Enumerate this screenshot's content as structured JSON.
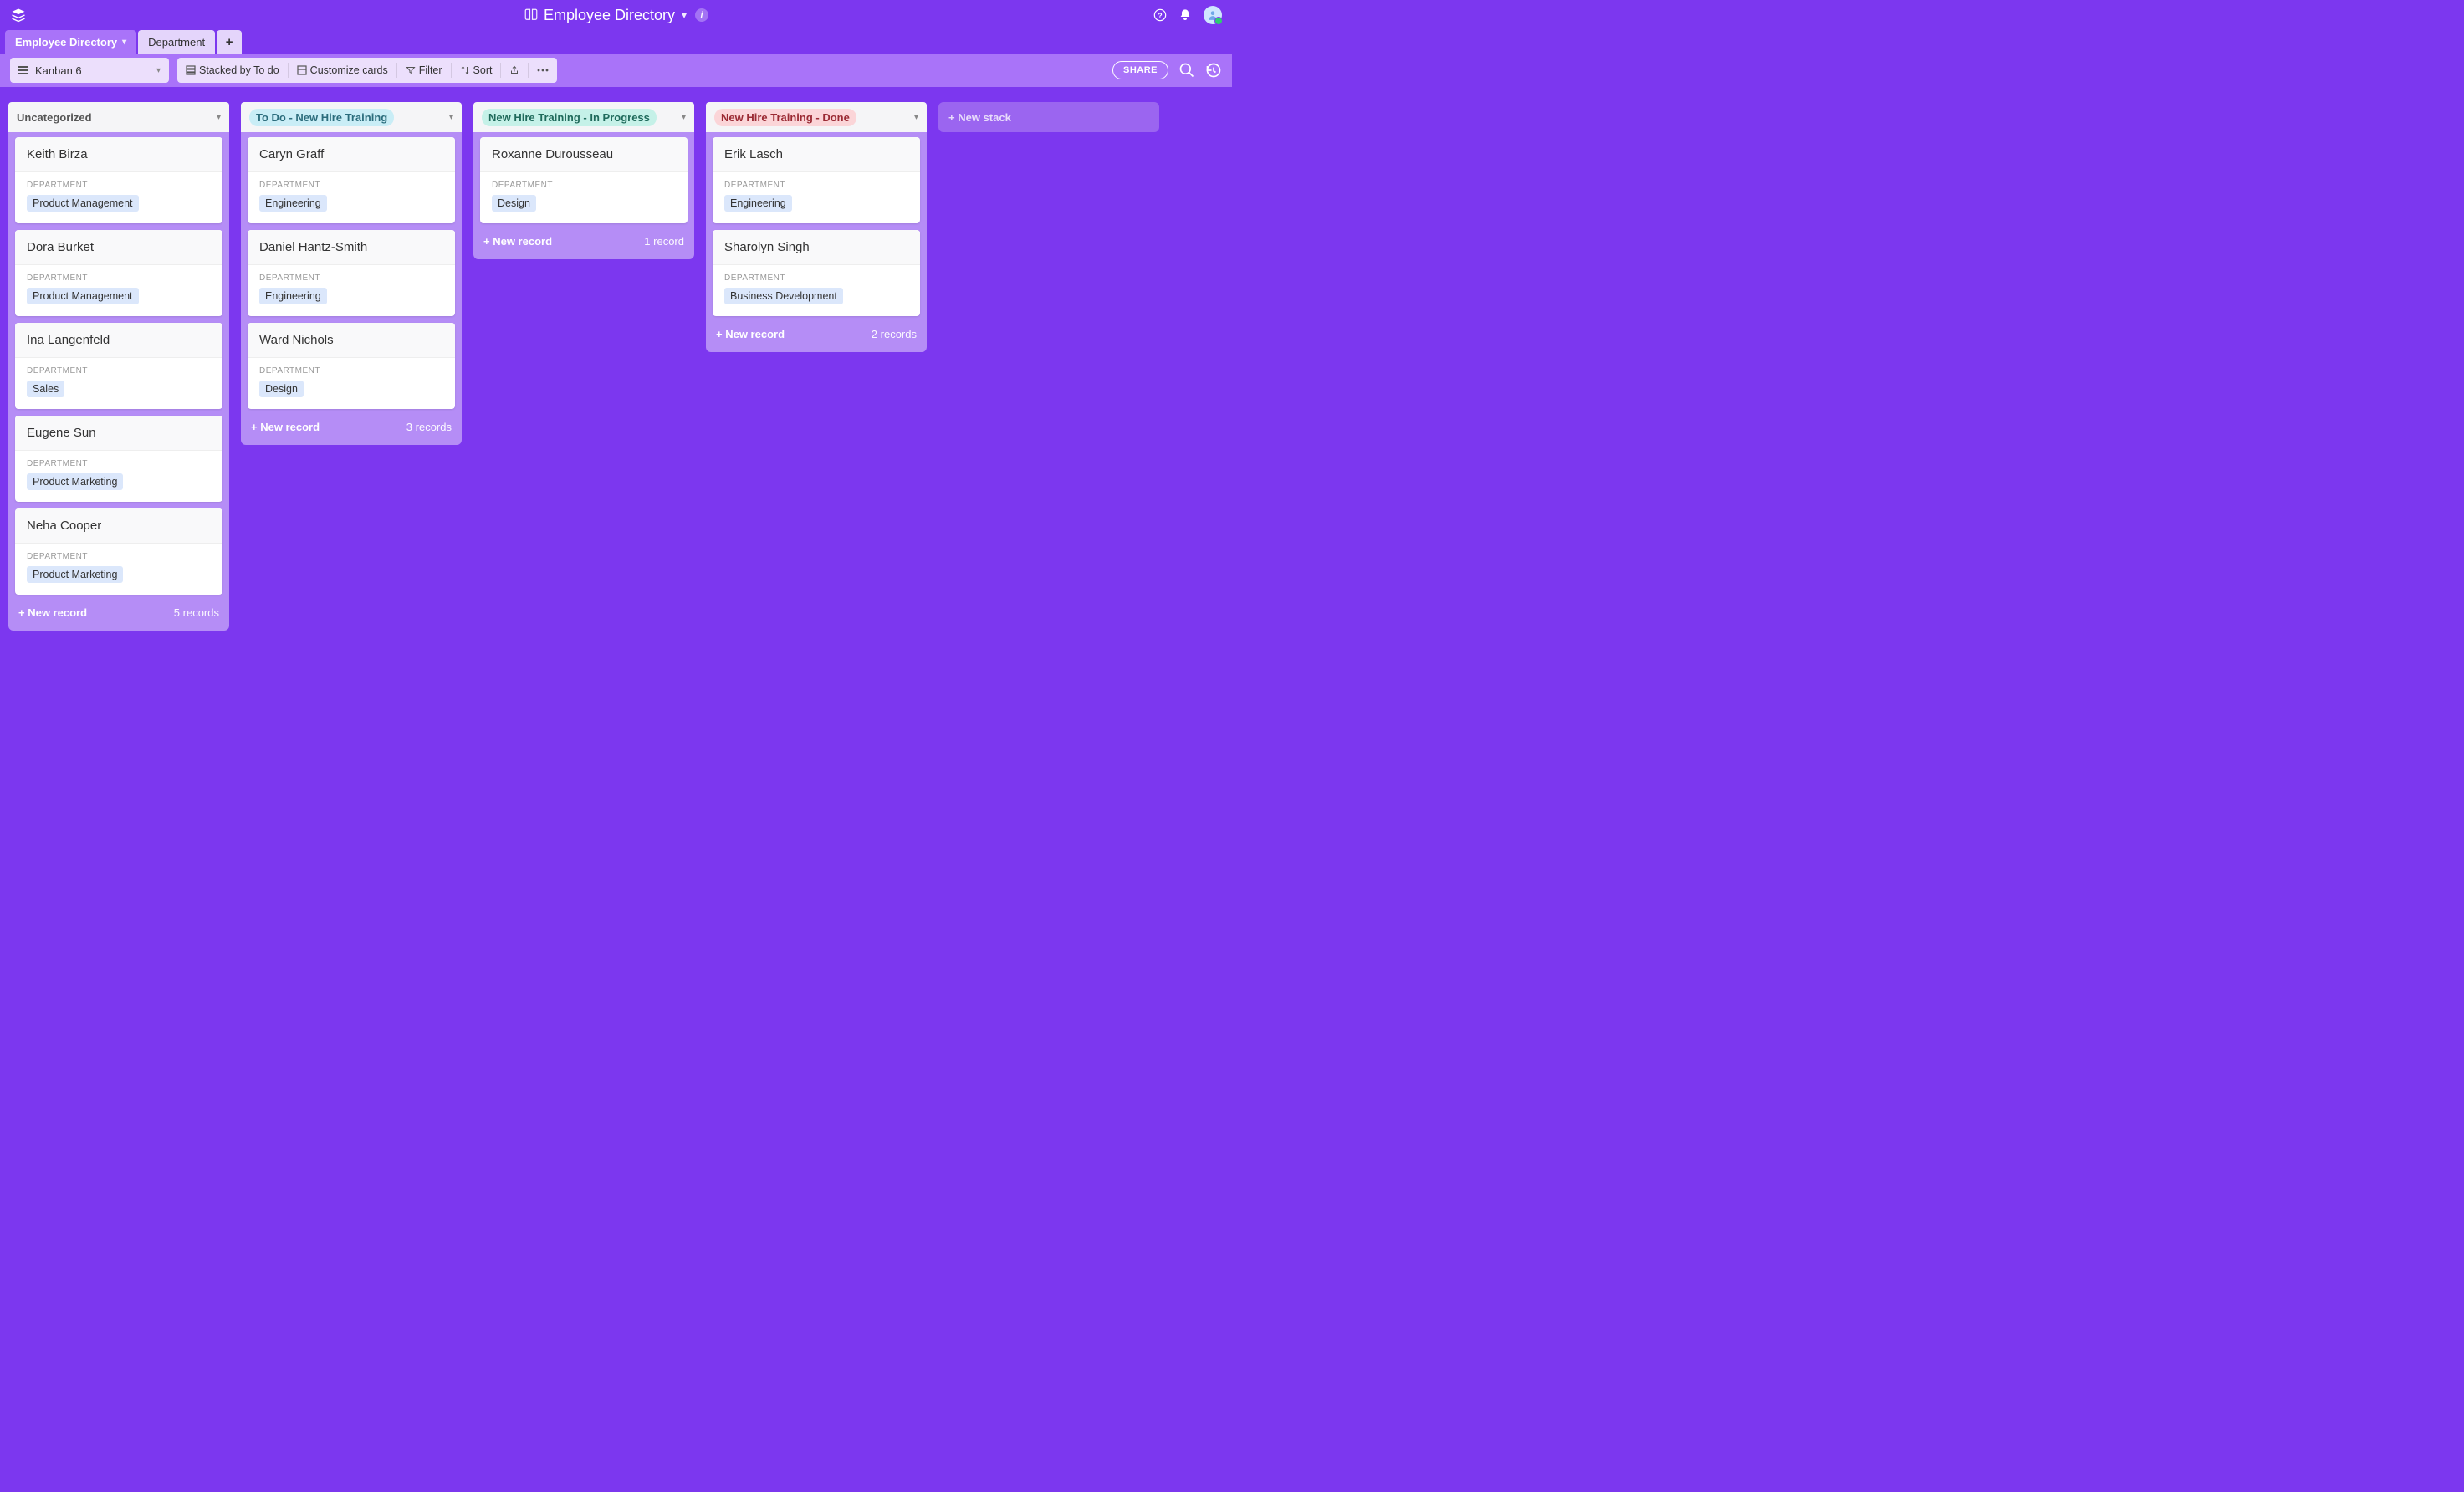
{
  "header": {
    "title": "Employee Directory"
  },
  "tabs": {
    "primary": "Employee Directory",
    "secondary": "Department",
    "add": "+"
  },
  "toolbar": {
    "view_name": "Kanban 6",
    "stacked_by": "Stacked by To do",
    "customize": "Customize cards",
    "filter": "Filter",
    "sort": "Sort",
    "share": "SHARE"
  },
  "board": {
    "new_stack": "+ New stack",
    "new_record": "+ New record",
    "field_label": "DEPARTMENT",
    "stacks": [
      {
        "title": "Uncategorized",
        "style": "plain",
        "count": "5 records",
        "cards": [
          {
            "name": "Keith Birza",
            "dept": "Product Management"
          },
          {
            "name": "Dora Burket",
            "dept": "Product Management"
          },
          {
            "name": "Ina Langenfeld",
            "dept": "Sales"
          },
          {
            "name": "Eugene Sun",
            "dept": "Product Marketing"
          },
          {
            "name": "Neha Cooper",
            "dept": "Product Marketing"
          }
        ]
      },
      {
        "title": "To Do - New Hire Training",
        "style": "blue",
        "count": "3 records",
        "cards": [
          {
            "name": "Caryn Graff",
            "dept": "Engineering"
          },
          {
            "name": "Daniel Hantz-Smith",
            "dept": "Engineering"
          },
          {
            "name": "Ward Nichols",
            "dept": "Design"
          }
        ]
      },
      {
        "title": "New Hire Training - In Progress",
        "style": "teal",
        "count": "1 record",
        "cards": [
          {
            "name": "Roxanne Durousseau",
            "dept": "Design"
          }
        ]
      },
      {
        "title": "New Hire Training - Done",
        "style": "red",
        "count": "2 records",
        "cards": [
          {
            "name": "Erik Lasch",
            "dept": "Engineering"
          },
          {
            "name": "Sharolyn Singh",
            "dept": "Business Development"
          }
        ]
      }
    ]
  }
}
